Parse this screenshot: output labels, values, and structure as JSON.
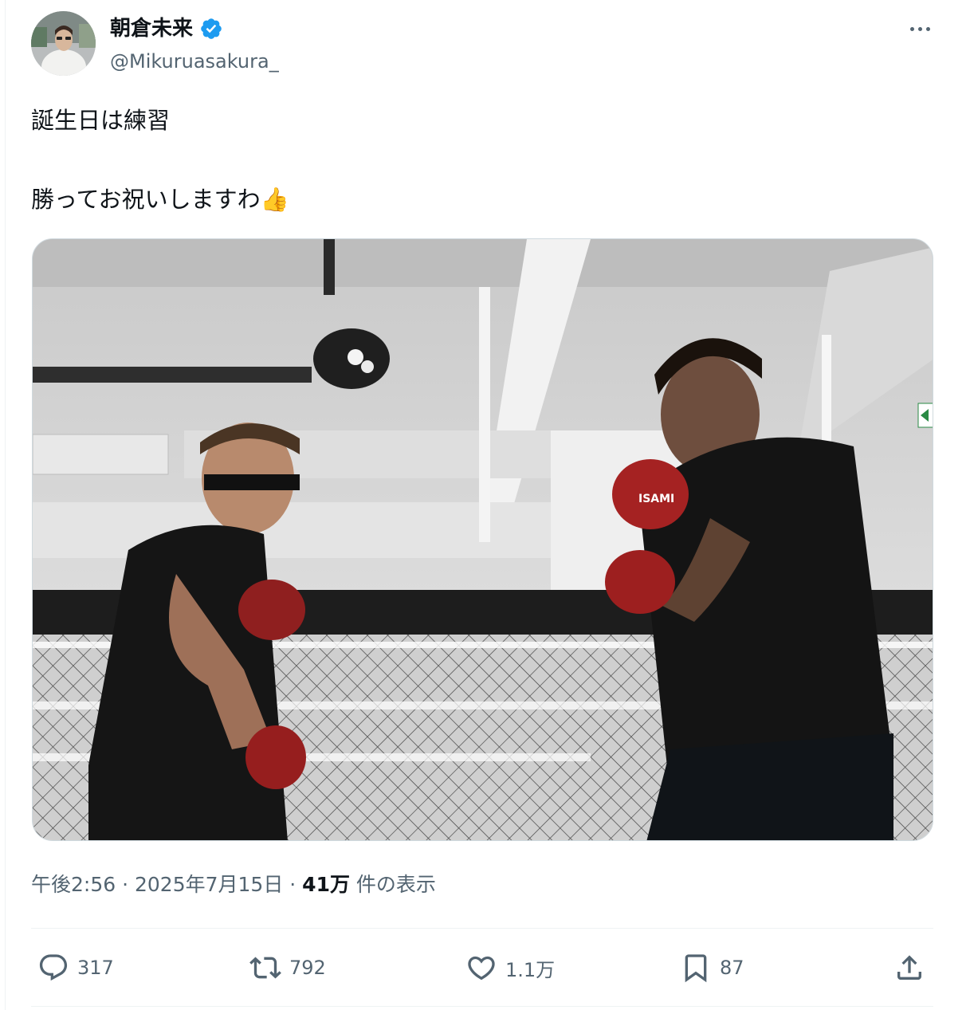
{
  "user": {
    "display_name": "朝倉未来",
    "handle": "@Mikuruasakura_",
    "verified_icon": "verified-badge-icon",
    "badge_color": "#1d9bf0"
  },
  "tweet": {
    "line1": "誕生日は練習",
    "line2": "勝ってお祝いしますわ👍"
  },
  "media": {
    "glove_label": "ISAMI"
  },
  "meta": {
    "time": "午後2:56",
    "separator": " · ",
    "date": "2025年7月15日",
    "separator2": " · ",
    "views_count": "41万",
    "views_label": " 件の表示"
  },
  "actions": {
    "replies": "317",
    "reposts": "792",
    "likes": "1.1万",
    "bookmarks": "87"
  },
  "icons": {
    "reply": "reply-icon",
    "repost": "repost-icon",
    "like": "heart-icon",
    "bookmark": "bookmark-icon",
    "share": "share-icon",
    "more": "more-icon"
  }
}
